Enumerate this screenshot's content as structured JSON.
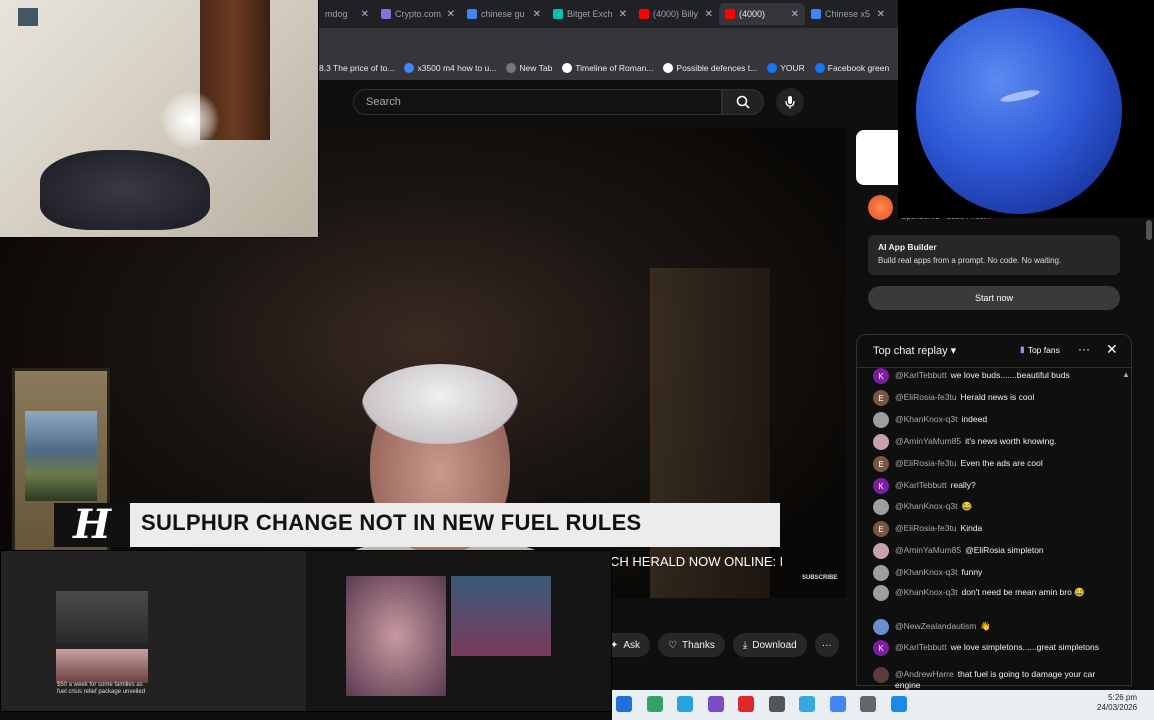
{
  "browser": {
    "tabs": [
      {
        "label": "mdog",
        "color": "#888888",
        "active": false
      },
      {
        "label": "Crypto.com",
        "color": "#8a6fdf",
        "active": false
      },
      {
        "label": "chinese gu",
        "color": "#4285f4",
        "active": false
      },
      {
        "label": "Bitget Exch",
        "color": "#00c2b2",
        "active": false
      },
      {
        "label": "(4000) Billy",
        "color": "#ff0000",
        "active": false
      },
      {
        "label": "(4000)",
        "color": "#ff0000",
        "active": true
      },
      {
        "label": "Chinese x5",
        "color": "#4285f4",
        "active": false
      }
    ],
    "bookmarks": [
      {
        "label": "8.3 The price of to...",
        "color": "#555555"
      },
      {
        "label": "x3500 m4 how to u...",
        "color": "#4285f4"
      },
      {
        "label": "New Tab",
        "color": "#777777"
      },
      {
        "label": "Timeline of Roman...",
        "color": "#ffffff"
      },
      {
        "label": "Possible defences t...",
        "color": "#ffffff"
      },
      {
        "label": "YOUR",
        "color": "#1877f2"
      },
      {
        "label": "Facebook green",
        "color": "#1877f2"
      }
    ]
  },
  "youtube": {
    "search_placeholder": "Search",
    "lower_third": {
      "logo": "H",
      "headline": "SULPHUR CHANGE NOT IN NEW FUEL RULES"
    },
    "ticker": "CH HERALD NOW ONLINE: N",
    "watermark": "SUBSCRIBE",
    "actions": {
      "ask": "Ask",
      "thanks": "Thanks",
      "download": "Download",
      "more": "···"
    }
  },
  "ad": {
    "sponsored": "Sponsored · base44.com",
    "title": "AI App Builder",
    "description": "Build real apps from a prompt. No code. No waiting.",
    "cta": "Start now"
  },
  "chat": {
    "header": "Top chat replay",
    "badge": "Top fans",
    "messages": [
      {
        "author": "@KarlTebbutt",
        "text": "we love buds.......beautiful buds",
        "initial": "K",
        "color": "#7b1fa2"
      },
      {
        "author": "@EliRosia-fe3tu",
        "text": "Herald news is cool",
        "initial": "E",
        "color": "#795548"
      },
      {
        "author": "@KhanKnox-q3t",
        "text": "indeed",
        "initial": "",
        "color": "#9e9e9e"
      },
      {
        "author": "@AminYaMum85",
        "text": "it's news worth knowing.",
        "initial": "",
        "color": "#c8a0b0"
      },
      {
        "author": "@EliRosia-fe3tu",
        "text": "Even the ads are cool",
        "initial": "E",
        "color": "#795548"
      },
      {
        "author": "@KarlTebbutt",
        "text": "really?",
        "initial": "K",
        "color": "#7b1fa2"
      },
      {
        "author": "@KhanKnox-q3t",
        "text": "😂",
        "initial": "",
        "color": "#9e9e9e"
      },
      {
        "author": "@EliRosia-fe3tu",
        "text": "Kinda",
        "initial": "E",
        "color": "#795548"
      },
      {
        "author": "@AminYaMum85",
        "text": "@EliRosia simpleton",
        "initial": "",
        "color": "#c8a0b0"
      },
      {
        "author": "@KhanKnox-q3t",
        "text": "funny",
        "initial": "",
        "color": "#9e9e9e"
      },
      {
        "author": "@KhanKnox-q3t",
        "text": "don't need be mean amin bro 😂",
        "initial": "",
        "color": "#9e9e9e"
      },
      {
        "author": "@NewZealandautism",
        "text": "👋",
        "initial": "",
        "color": "#6a8fcf"
      },
      {
        "author": "@KarlTebbutt",
        "text": "we love simpletons......great simpletons",
        "initial": "K",
        "color": "#7b1fa2"
      },
      {
        "author": "@AndrewHarre",
        "text": "that fuel is going to damage your car engine",
        "initial": "",
        "color": "#5a3a3a"
      }
    ]
  },
  "screenshare": {
    "caption": "$50 a week for some families as fuel crisis relief package unveiled"
  },
  "taskbar": {
    "time": "5:26 pm",
    "date": "24/03/2026",
    "icons": [
      "folder-icon",
      "video-app-icon",
      "telegram-icon",
      "purple-app-icon",
      "red-app-icon",
      "gamepad-icon",
      "edge-icon",
      "chrome-icon",
      "settings-icon",
      "pin-icon"
    ]
  }
}
